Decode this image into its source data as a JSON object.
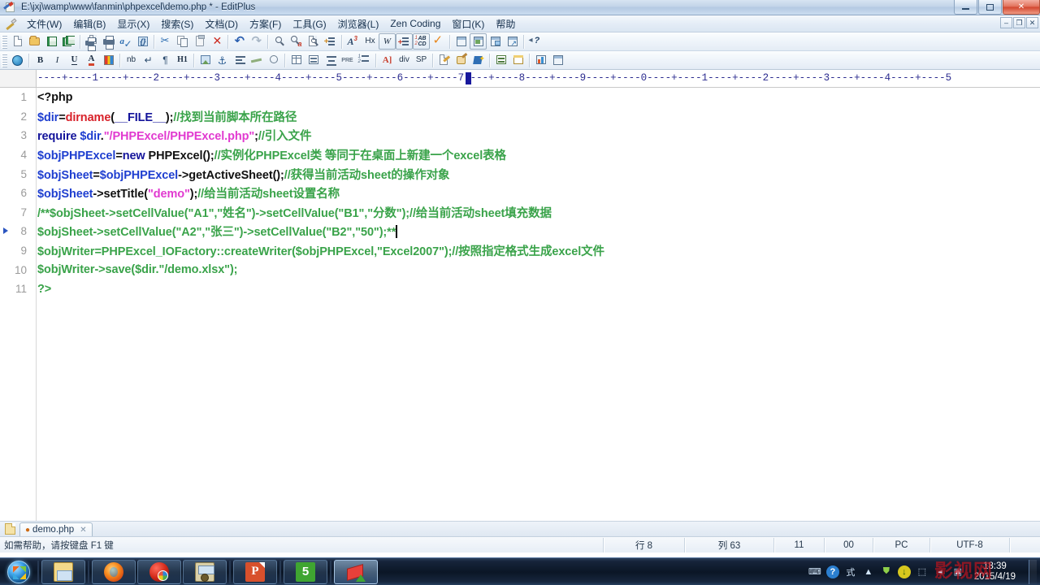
{
  "window": {
    "title": "E:\\jxj\\wamp\\www\\fanmin\\phpexcel\\demo.php * - EditPlus",
    "icon": "editplus-icon",
    "minimize_label": "–",
    "maximize_label": "□",
    "close_label": "✕"
  },
  "menubar": {
    "items": [
      {
        "label": "文件(W)"
      },
      {
        "label": "编辑(B)"
      },
      {
        "label": "显示(X)"
      },
      {
        "label": "搜索(S)"
      },
      {
        "label": "文档(D)"
      },
      {
        "label": "方案(F)"
      },
      {
        "label": "工具(G)"
      },
      {
        "label": "浏览器(L)"
      },
      {
        "label": "Zen Coding"
      },
      {
        "label": "窗口(K)"
      },
      {
        "label": "帮助"
      }
    ],
    "mdi_buttons": [
      {
        "name": "mdi-minimize",
        "label": "–"
      },
      {
        "name": "mdi-restore",
        "label": "❐"
      },
      {
        "name": "mdi-close",
        "label": "✕"
      }
    ]
  },
  "toolbar_primary": {
    "buttons": [
      {
        "name": "new-file-button",
        "icon": "new-document-icon"
      },
      {
        "name": "open-file-button",
        "icon": "open-folder-icon"
      },
      {
        "name": "save-file-button",
        "icon": "save-disk-icon"
      },
      {
        "name": "save-all-button",
        "icon": "save-all-icon"
      },
      {
        "name": "print-preview-button",
        "icon": "print-preview-icon"
      },
      {
        "name": "print-button",
        "icon": "printer-icon"
      },
      {
        "name": "spell-check-button",
        "icon": "spellcheck-icon"
      },
      {
        "name": "run-browser-button",
        "icon": "run-page-icon"
      },
      {
        "name": "cut-button",
        "icon": "scissors-icon"
      },
      {
        "name": "copy-button",
        "icon": "copy-icon"
      },
      {
        "name": "paste-button",
        "icon": "clipboard-icon"
      },
      {
        "name": "delete-button",
        "icon": "delete-x-icon"
      },
      {
        "name": "undo-button",
        "icon": "undo-arrow-icon"
      },
      {
        "name": "redo-button",
        "icon": "redo-arrow-icon"
      },
      {
        "name": "find-button",
        "icon": "magnifier-icon"
      },
      {
        "name": "replace-button",
        "icon": "find-replace-icon"
      },
      {
        "name": "find-in-files-button",
        "icon": "find-in-files-icon"
      },
      {
        "name": "goto-line-button",
        "icon": "goto-line-icon"
      },
      {
        "name": "font-size-button",
        "icon": "superscript-a-icon"
      },
      {
        "name": "hex-view-button",
        "icon": "hex-icon",
        "label": "Hx"
      },
      {
        "name": "match-word-button",
        "icon": "whole-word-icon",
        "label": "W"
      },
      {
        "name": "line-numbers-button",
        "icon": "line-numbers-icon"
      },
      {
        "name": "match-case-button",
        "icon": "match-case-icon"
      },
      {
        "name": "validate-button",
        "icon": "orange-check-icon"
      },
      {
        "name": "toggle-output-button",
        "icon": "output-window-icon"
      },
      {
        "name": "toggle-directory-button",
        "icon": "directory-window-icon"
      },
      {
        "name": "toggle-clipboard-button",
        "icon": "clip-window-icon"
      },
      {
        "name": "fullscreen-button",
        "icon": "fullscreen-icon"
      },
      {
        "name": "context-help-button",
        "icon": "help-pointer-icon",
        "label": "?"
      }
    ]
  },
  "toolbar_html": {
    "buttons": [
      {
        "name": "browser-preview-button",
        "icon": "globe-icon"
      },
      {
        "name": "bold-button",
        "icon": "bold-icon",
        "label": "B"
      },
      {
        "name": "italic-button",
        "icon": "italic-icon",
        "label": "I"
      },
      {
        "name": "underline-button",
        "icon": "underline-icon",
        "label": "U"
      },
      {
        "name": "font-color-button",
        "icon": "font-color-icon",
        "label": "A"
      },
      {
        "name": "color-picker-button",
        "icon": "palette-icon"
      },
      {
        "name": "nbsp-button",
        "icon": "nbsp-icon",
        "label": "nb"
      },
      {
        "name": "line-break-button",
        "icon": "line-break-icon",
        "label": "↵"
      },
      {
        "name": "paragraph-button",
        "icon": "paragraph-icon",
        "label": "¶"
      },
      {
        "name": "heading-button",
        "icon": "heading-icon",
        "label": "H1"
      },
      {
        "name": "insert-image-button",
        "icon": "image-icon"
      },
      {
        "name": "anchor-button",
        "icon": "anchor-icon"
      },
      {
        "name": "align-left-button",
        "icon": "align-left-icon"
      },
      {
        "name": "horizontal-rule-button",
        "icon": "hr-icon"
      },
      {
        "name": "comment-button",
        "icon": "comment-icon"
      },
      {
        "name": "table-button",
        "icon": "table-icon"
      },
      {
        "name": "list-button",
        "icon": "list-icon"
      },
      {
        "name": "indent-button",
        "icon": "indent-icon"
      },
      {
        "name": "pre-button",
        "icon": "pre-icon",
        "label": "PRE"
      },
      {
        "name": "ordered-list-button",
        "icon": "ordered-list-icon"
      },
      {
        "name": "anchor-tag-button",
        "icon": "anchor-tag-icon",
        "label": "A]"
      },
      {
        "name": "div-button",
        "icon": "div-icon",
        "label": "div"
      },
      {
        "name": "span-button",
        "icon": "span-icon",
        "label": "SP"
      },
      {
        "name": "edit-tag-button",
        "icon": "edit-tag-icon"
      },
      {
        "name": "css-button",
        "icon": "css-icon"
      },
      {
        "name": "script-button",
        "icon": "script-icon"
      },
      {
        "name": "form-button",
        "icon": "form-icon"
      },
      {
        "name": "table-props-button",
        "icon": "table-props-icon"
      },
      {
        "name": "chart-button",
        "icon": "chart-icon"
      },
      {
        "name": "window-button",
        "icon": "window-icon"
      }
    ]
  },
  "ruler": {
    "marks": "----+----1----+----2----+----3----+----4----+----5----+----6----+----7----+----8----+----9----+----0----+----1----+----2----+----3----+----4----+----5",
    "caret_column": 63
  },
  "editor": {
    "lines": [
      {
        "num": "1",
        "bookmark": false,
        "tokens": [
          {
            "t": "<?php",
            "c": "pln"
          }
        ]
      },
      {
        "num": "2",
        "bookmark": false,
        "tokens": [
          {
            "t": "$dir",
            "c": "var"
          },
          {
            "t": "=",
            "c": "op"
          },
          {
            "t": "dirname",
            "c": "fun"
          },
          {
            "t": "(",
            "c": "op"
          },
          {
            "t": "__FILE__",
            "c": "kw"
          },
          {
            "t": ");",
            "c": "op"
          },
          {
            "t": "//找到当前脚本所在路径",
            "c": "com"
          }
        ]
      },
      {
        "num": "3",
        "bookmark": false,
        "tokens": [
          {
            "t": "require ",
            "c": "kw"
          },
          {
            "t": "$dir",
            "c": "var"
          },
          {
            "t": ".",
            "c": "op"
          },
          {
            "t": "\"/PHPExcel/PHPExcel.php\"",
            "c": "str"
          },
          {
            "t": ";",
            "c": "op"
          },
          {
            "t": "//引入文件",
            "c": "com"
          }
        ]
      },
      {
        "num": "4",
        "bookmark": false,
        "tokens": [
          {
            "t": "$objPHPExcel",
            "c": "var"
          },
          {
            "t": "=",
            "c": "op"
          },
          {
            "t": "new ",
            "c": "kw"
          },
          {
            "t": "PHPExcel();",
            "c": "pln"
          },
          {
            "t": "//实例化PHPExcel类 等同于在桌面上新建一个excel表格",
            "c": "com"
          }
        ]
      },
      {
        "num": "5",
        "bookmark": false,
        "tokens": [
          {
            "t": "$objSheet",
            "c": "var"
          },
          {
            "t": "=",
            "c": "op"
          },
          {
            "t": "$objPHPExcel",
            "c": "var"
          },
          {
            "t": "->",
            "c": "op"
          },
          {
            "t": "getActiveSheet();",
            "c": "pln"
          },
          {
            "t": "//获得当前活动sheet的操作对象",
            "c": "com"
          }
        ]
      },
      {
        "num": "6",
        "bookmark": false,
        "tokens": [
          {
            "t": "$objSheet",
            "c": "var"
          },
          {
            "t": "->",
            "c": "op"
          },
          {
            "t": "setTitle(",
            "c": "pln"
          },
          {
            "t": "\"demo\"",
            "c": "str"
          },
          {
            "t": ");",
            "c": "pln"
          },
          {
            "t": "//给当前活动sheet设置名称",
            "c": "com"
          }
        ]
      },
      {
        "num": "7",
        "bookmark": false,
        "tokens": [
          {
            "t": "/**$objSheet->setCellValue(\"A1\",\"姓名\")->setCellValue(\"B1\",\"分数\");//给当前活动sheet填充数据",
            "c": "com"
          }
        ]
      },
      {
        "num": "8",
        "bookmark": true,
        "caret": true,
        "tokens": [
          {
            "t": "$objSheet->setCellValue(\"A2\",\"张三\")->setCellValue(\"B2\",\"50\");**",
            "c": "com"
          }
        ]
      },
      {
        "num": "9",
        "bookmark": false,
        "tokens": [
          {
            "t": "$objWriter=PHPExcel_IOFactory::createWriter($objPHPExcel,\"Excel2007\");//按照指定格式生成excel文件",
            "c": "com"
          }
        ]
      },
      {
        "num": "10",
        "bookmark": false,
        "tokens": [
          {
            "t": "$objWriter->save($dir.\"/demo.xlsx\");",
            "c": "com"
          }
        ]
      },
      {
        "num": "11",
        "bookmark": false,
        "tokens": [
          {
            "t": "?>",
            "c": "com"
          }
        ]
      }
    ],
    "colors": {
      "comment": "#3aa34a",
      "variable": "#1f3fd0",
      "function": "#d8222a",
      "string": "#e13ad0",
      "keyword": "#14149b",
      "plain": "#111111"
    }
  },
  "tabbar": {
    "tabs": [
      {
        "name": "tab-demo-php",
        "modified_dot": "●",
        "label": "demo.php",
        "close": "✕"
      }
    ]
  },
  "statusbar": {
    "hint": "如需帮助，请按键盘 F1 键",
    "cells": [
      {
        "name": "status-line",
        "label": "行 8"
      },
      {
        "name": "status-column",
        "label": "列 63"
      },
      {
        "name": "status-lines-total",
        "label": "11"
      },
      {
        "name": "status-selection",
        "label": "00"
      },
      {
        "name": "status-eol",
        "label": "PC"
      },
      {
        "name": "status-encoding",
        "label": "UTF-8"
      }
    ]
  },
  "taskbar": {
    "start_label": "Start",
    "items": [
      {
        "name": "taskbar-windows-explorer",
        "icon": "folder-explorer-icon",
        "active": false
      },
      {
        "name": "taskbar-firefox",
        "icon": "firefox-icon",
        "active": false
      },
      {
        "name": "taskbar-media-player",
        "icon": "red-media-icon",
        "active": false
      },
      {
        "name": "taskbar-vault",
        "icon": "safe-vault-icon",
        "active": false
      },
      {
        "name": "taskbar-powerpoint",
        "icon": "powerpoint-icon",
        "label": "P",
        "active": false
      },
      {
        "name": "taskbar-sogou",
        "icon": "sogou-s-icon",
        "label": "5",
        "active": false
      },
      {
        "name": "taskbar-editplus",
        "icon": "editplus-icon",
        "active": true
      }
    ],
    "tray": [
      {
        "name": "tray-keyboard-icon",
        "glyph": "⌨"
      },
      {
        "name": "tray-help-icon",
        "glyph": "?"
      },
      {
        "name": "tray-ime-icon",
        "glyph": "式"
      },
      {
        "name": "tray-show-hidden-icon",
        "glyph": "▲"
      },
      {
        "name": "tray-security-icon",
        "glyph": "⛊"
      },
      {
        "name": "tray-update-icon",
        "glyph": "↓"
      },
      {
        "name": "tray-removable-icon",
        "glyph": "⬚"
      },
      {
        "name": "tray-volume-icon",
        "glyph": "◂"
      },
      {
        "name": "tray-network-icon",
        "glyph": "▣"
      }
    ],
    "clock": {
      "time": "18:39",
      "date": "2015/4/19"
    },
    "watermark": {
      "text": "影视网",
      "sub": ""
    }
  }
}
